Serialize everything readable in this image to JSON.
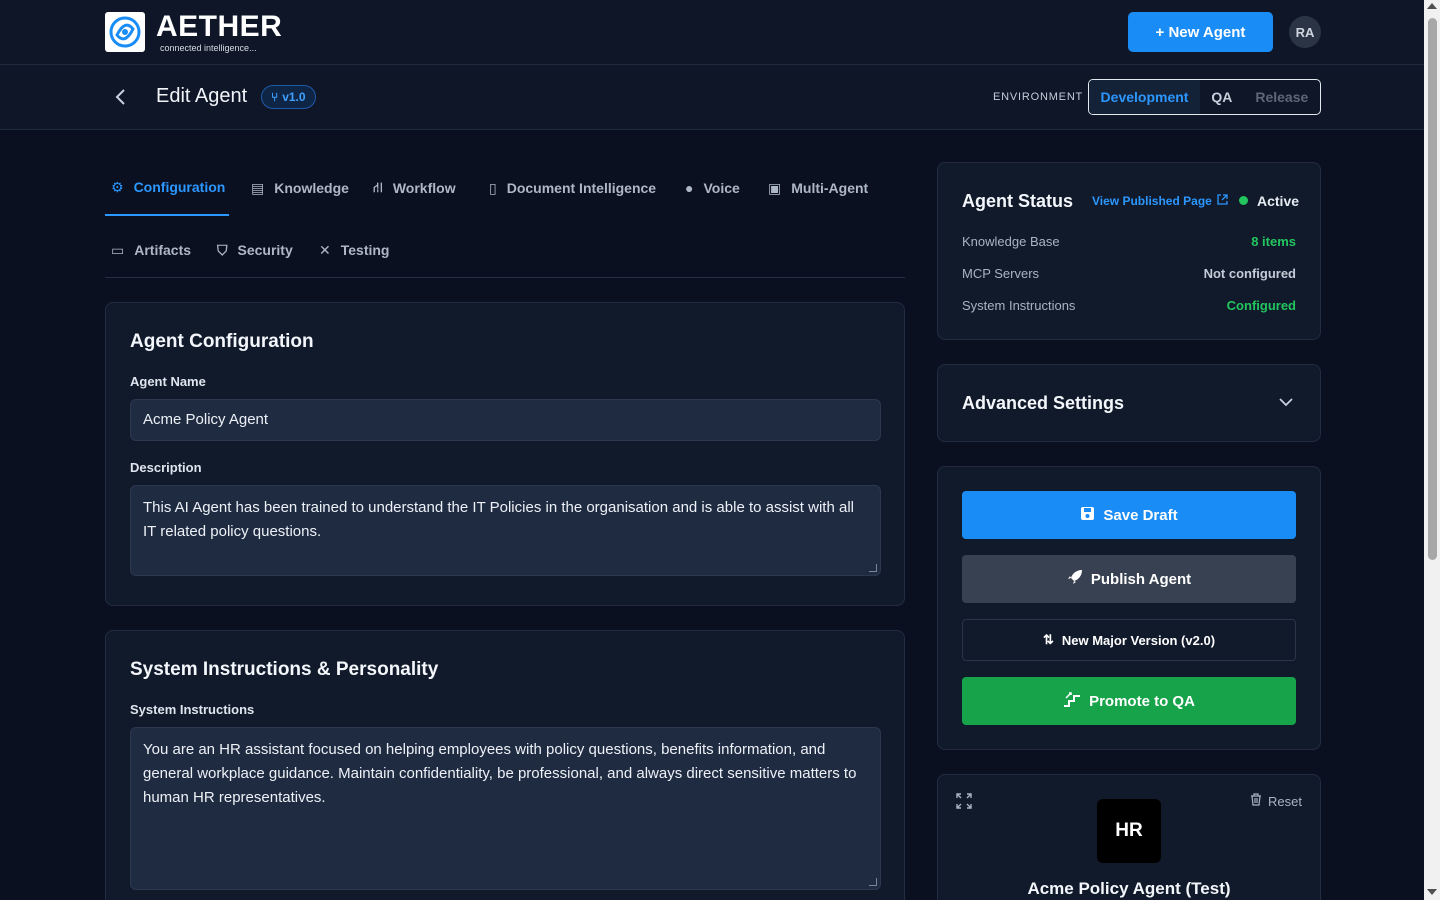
{
  "header": {
    "brand": "AETHER",
    "tagline": "connected intelligence...",
    "new_agent_label": "+ New Agent",
    "avatar_initials": "RA"
  },
  "subheader": {
    "title": "Edit Agent",
    "version": "v1.0",
    "env_label": "ENVIRONMENT",
    "env_options": [
      "Development",
      "QA",
      "Release"
    ],
    "env_selected": "Development"
  },
  "tabs": [
    {
      "label": "Configuration",
      "icon": "gear-icon",
      "active": true
    },
    {
      "label": "Knowledge",
      "icon": "book-icon"
    },
    {
      "label": "Workflow",
      "icon": "workflow-icon"
    },
    {
      "label": "Document Intelligence",
      "icon": "document-icon"
    },
    {
      "label": "Voice",
      "icon": "microphone-icon"
    },
    {
      "label": "Multi-Agent",
      "icon": "robot-icon"
    },
    {
      "label": "Artifacts",
      "icon": "archive-icon"
    },
    {
      "label": "Security",
      "icon": "shield-icon"
    },
    {
      "label": "Testing",
      "icon": "tools-icon"
    }
  ],
  "config": {
    "title": "Agent Configuration",
    "name_label": "Agent Name",
    "name_value": "Acme Policy Agent",
    "desc_label": "Description",
    "desc_value": "This AI Agent has been trained to understand the IT Policies in the organisation and is able to assist with all IT related policy questions."
  },
  "instructions": {
    "title": "System Instructions & Personality",
    "label": "System Instructions",
    "value": "You are an HR assistant focused on helping employees with policy questions, benefits information, and general workplace guidance. Maintain confidentiality, be professional, and always direct sensitive matters to human HR representatives."
  },
  "status": {
    "title": "Agent Status",
    "view_link": "View Published Page",
    "state": "Active",
    "rows": [
      {
        "key": "Knowledge Base",
        "value": "8 items"
      },
      {
        "key": "MCP Servers",
        "value": "Not configured"
      },
      {
        "key": "System Instructions",
        "value": "Configured"
      }
    ]
  },
  "advanced": {
    "title": "Advanced Settings"
  },
  "actions": {
    "save": "Save Draft",
    "publish": "Publish Agent",
    "major": "New Major Version (v2.0)",
    "promote": "Promote to QA"
  },
  "preview": {
    "initials": "HR",
    "reset": "Reset",
    "name": "Acme Policy Agent (Test)"
  },
  "colors": {
    "accent": "#1a8cf5",
    "success": "#22c55e",
    "promote": "#16a34a",
    "background": "#0b1020"
  }
}
